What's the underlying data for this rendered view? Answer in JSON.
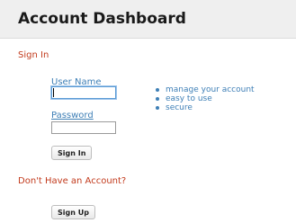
{
  "header": {
    "title": "Account Dashboard"
  },
  "sign_in": {
    "heading": "Sign In",
    "username_label": "User Name",
    "username_value": "",
    "password_label": "Password",
    "password_value": "",
    "button_label": "Sign In",
    "benefits": [
      "manage your account",
      "easy to use",
      "secure"
    ]
  },
  "sign_up": {
    "heading": "Don't Have an Account?",
    "button_label": "Sign Up"
  },
  "colors": {
    "heading_accent": "#c23a1c",
    "link_blue": "#3e7fb6",
    "header_bg": "#efefef"
  }
}
